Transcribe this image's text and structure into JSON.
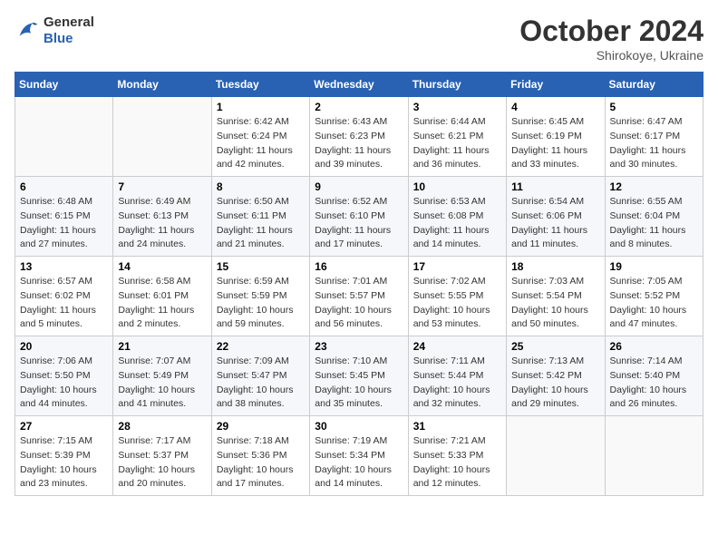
{
  "header": {
    "logo_line1": "General",
    "logo_line2": "Blue",
    "month_title": "October 2024",
    "location": "Shirokoye, Ukraine"
  },
  "days_of_week": [
    "Sunday",
    "Monday",
    "Tuesday",
    "Wednesday",
    "Thursday",
    "Friday",
    "Saturday"
  ],
  "weeks": [
    [
      {
        "day": "",
        "info": ""
      },
      {
        "day": "",
        "info": ""
      },
      {
        "day": "1",
        "info": "Sunrise: 6:42 AM\nSunset: 6:24 PM\nDaylight: 11 hours and 42 minutes."
      },
      {
        "day": "2",
        "info": "Sunrise: 6:43 AM\nSunset: 6:23 PM\nDaylight: 11 hours and 39 minutes."
      },
      {
        "day": "3",
        "info": "Sunrise: 6:44 AM\nSunset: 6:21 PM\nDaylight: 11 hours and 36 minutes."
      },
      {
        "day": "4",
        "info": "Sunrise: 6:45 AM\nSunset: 6:19 PM\nDaylight: 11 hours and 33 minutes."
      },
      {
        "day": "5",
        "info": "Sunrise: 6:47 AM\nSunset: 6:17 PM\nDaylight: 11 hours and 30 minutes."
      }
    ],
    [
      {
        "day": "6",
        "info": "Sunrise: 6:48 AM\nSunset: 6:15 PM\nDaylight: 11 hours and 27 minutes."
      },
      {
        "day": "7",
        "info": "Sunrise: 6:49 AM\nSunset: 6:13 PM\nDaylight: 11 hours and 24 minutes."
      },
      {
        "day": "8",
        "info": "Sunrise: 6:50 AM\nSunset: 6:11 PM\nDaylight: 11 hours and 21 minutes."
      },
      {
        "day": "9",
        "info": "Sunrise: 6:52 AM\nSunset: 6:10 PM\nDaylight: 11 hours and 17 minutes."
      },
      {
        "day": "10",
        "info": "Sunrise: 6:53 AM\nSunset: 6:08 PM\nDaylight: 11 hours and 14 minutes."
      },
      {
        "day": "11",
        "info": "Sunrise: 6:54 AM\nSunset: 6:06 PM\nDaylight: 11 hours and 11 minutes."
      },
      {
        "day": "12",
        "info": "Sunrise: 6:55 AM\nSunset: 6:04 PM\nDaylight: 11 hours and 8 minutes."
      }
    ],
    [
      {
        "day": "13",
        "info": "Sunrise: 6:57 AM\nSunset: 6:02 PM\nDaylight: 11 hours and 5 minutes."
      },
      {
        "day": "14",
        "info": "Sunrise: 6:58 AM\nSunset: 6:01 PM\nDaylight: 11 hours and 2 minutes."
      },
      {
        "day": "15",
        "info": "Sunrise: 6:59 AM\nSunset: 5:59 PM\nDaylight: 10 hours and 59 minutes."
      },
      {
        "day": "16",
        "info": "Sunrise: 7:01 AM\nSunset: 5:57 PM\nDaylight: 10 hours and 56 minutes."
      },
      {
        "day": "17",
        "info": "Sunrise: 7:02 AM\nSunset: 5:55 PM\nDaylight: 10 hours and 53 minutes."
      },
      {
        "day": "18",
        "info": "Sunrise: 7:03 AM\nSunset: 5:54 PM\nDaylight: 10 hours and 50 minutes."
      },
      {
        "day": "19",
        "info": "Sunrise: 7:05 AM\nSunset: 5:52 PM\nDaylight: 10 hours and 47 minutes."
      }
    ],
    [
      {
        "day": "20",
        "info": "Sunrise: 7:06 AM\nSunset: 5:50 PM\nDaylight: 10 hours and 44 minutes."
      },
      {
        "day": "21",
        "info": "Sunrise: 7:07 AM\nSunset: 5:49 PM\nDaylight: 10 hours and 41 minutes."
      },
      {
        "day": "22",
        "info": "Sunrise: 7:09 AM\nSunset: 5:47 PM\nDaylight: 10 hours and 38 minutes."
      },
      {
        "day": "23",
        "info": "Sunrise: 7:10 AM\nSunset: 5:45 PM\nDaylight: 10 hours and 35 minutes."
      },
      {
        "day": "24",
        "info": "Sunrise: 7:11 AM\nSunset: 5:44 PM\nDaylight: 10 hours and 32 minutes."
      },
      {
        "day": "25",
        "info": "Sunrise: 7:13 AM\nSunset: 5:42 PM\nDaylight: 10 hours and 29 minutes."
      },
      {
        "day": "26",
        "info": "Sunrise: 7:14 AM\nSunset: 5:40 PM\nDaylight: 10 hours and 26 minutes."
      }
    ],
    [
      {
        "day": "27",
        "info": "Sunrise: 7:15 AM\nSunset: 5:39 PM\nDaylight: 10 hours and 23 minutes."
      },
      {
        "day": "28",
        "info": "Sunrise: 7:17 AM\nSunset: 5:37 PM\nDaylight: 10 hours and 20 minutes."
      },
      {
        "day": "29",
        "info": "Sunrise: 7:18 AM\nSunset: 5:36 PM\nDaylight: 10 hours and 17 minutes."
      },
      {
        "day": "30",
        "info": "Sunrise: 7:19 AM\nSunset: 5:34 PM\nDaylight: 10 hours and 14 minutes."
      },
      {
        "day": "31",
        "info": "Sunrise: 7:21 AM\nSunset: 5:33 PM\nDaylight: 10 hours and 12 minutes."
      },
      {
        "day": "",
        "info": ""
      },
      {
        "day": "",
        "info": ""
      }
    ]
  ]
}
